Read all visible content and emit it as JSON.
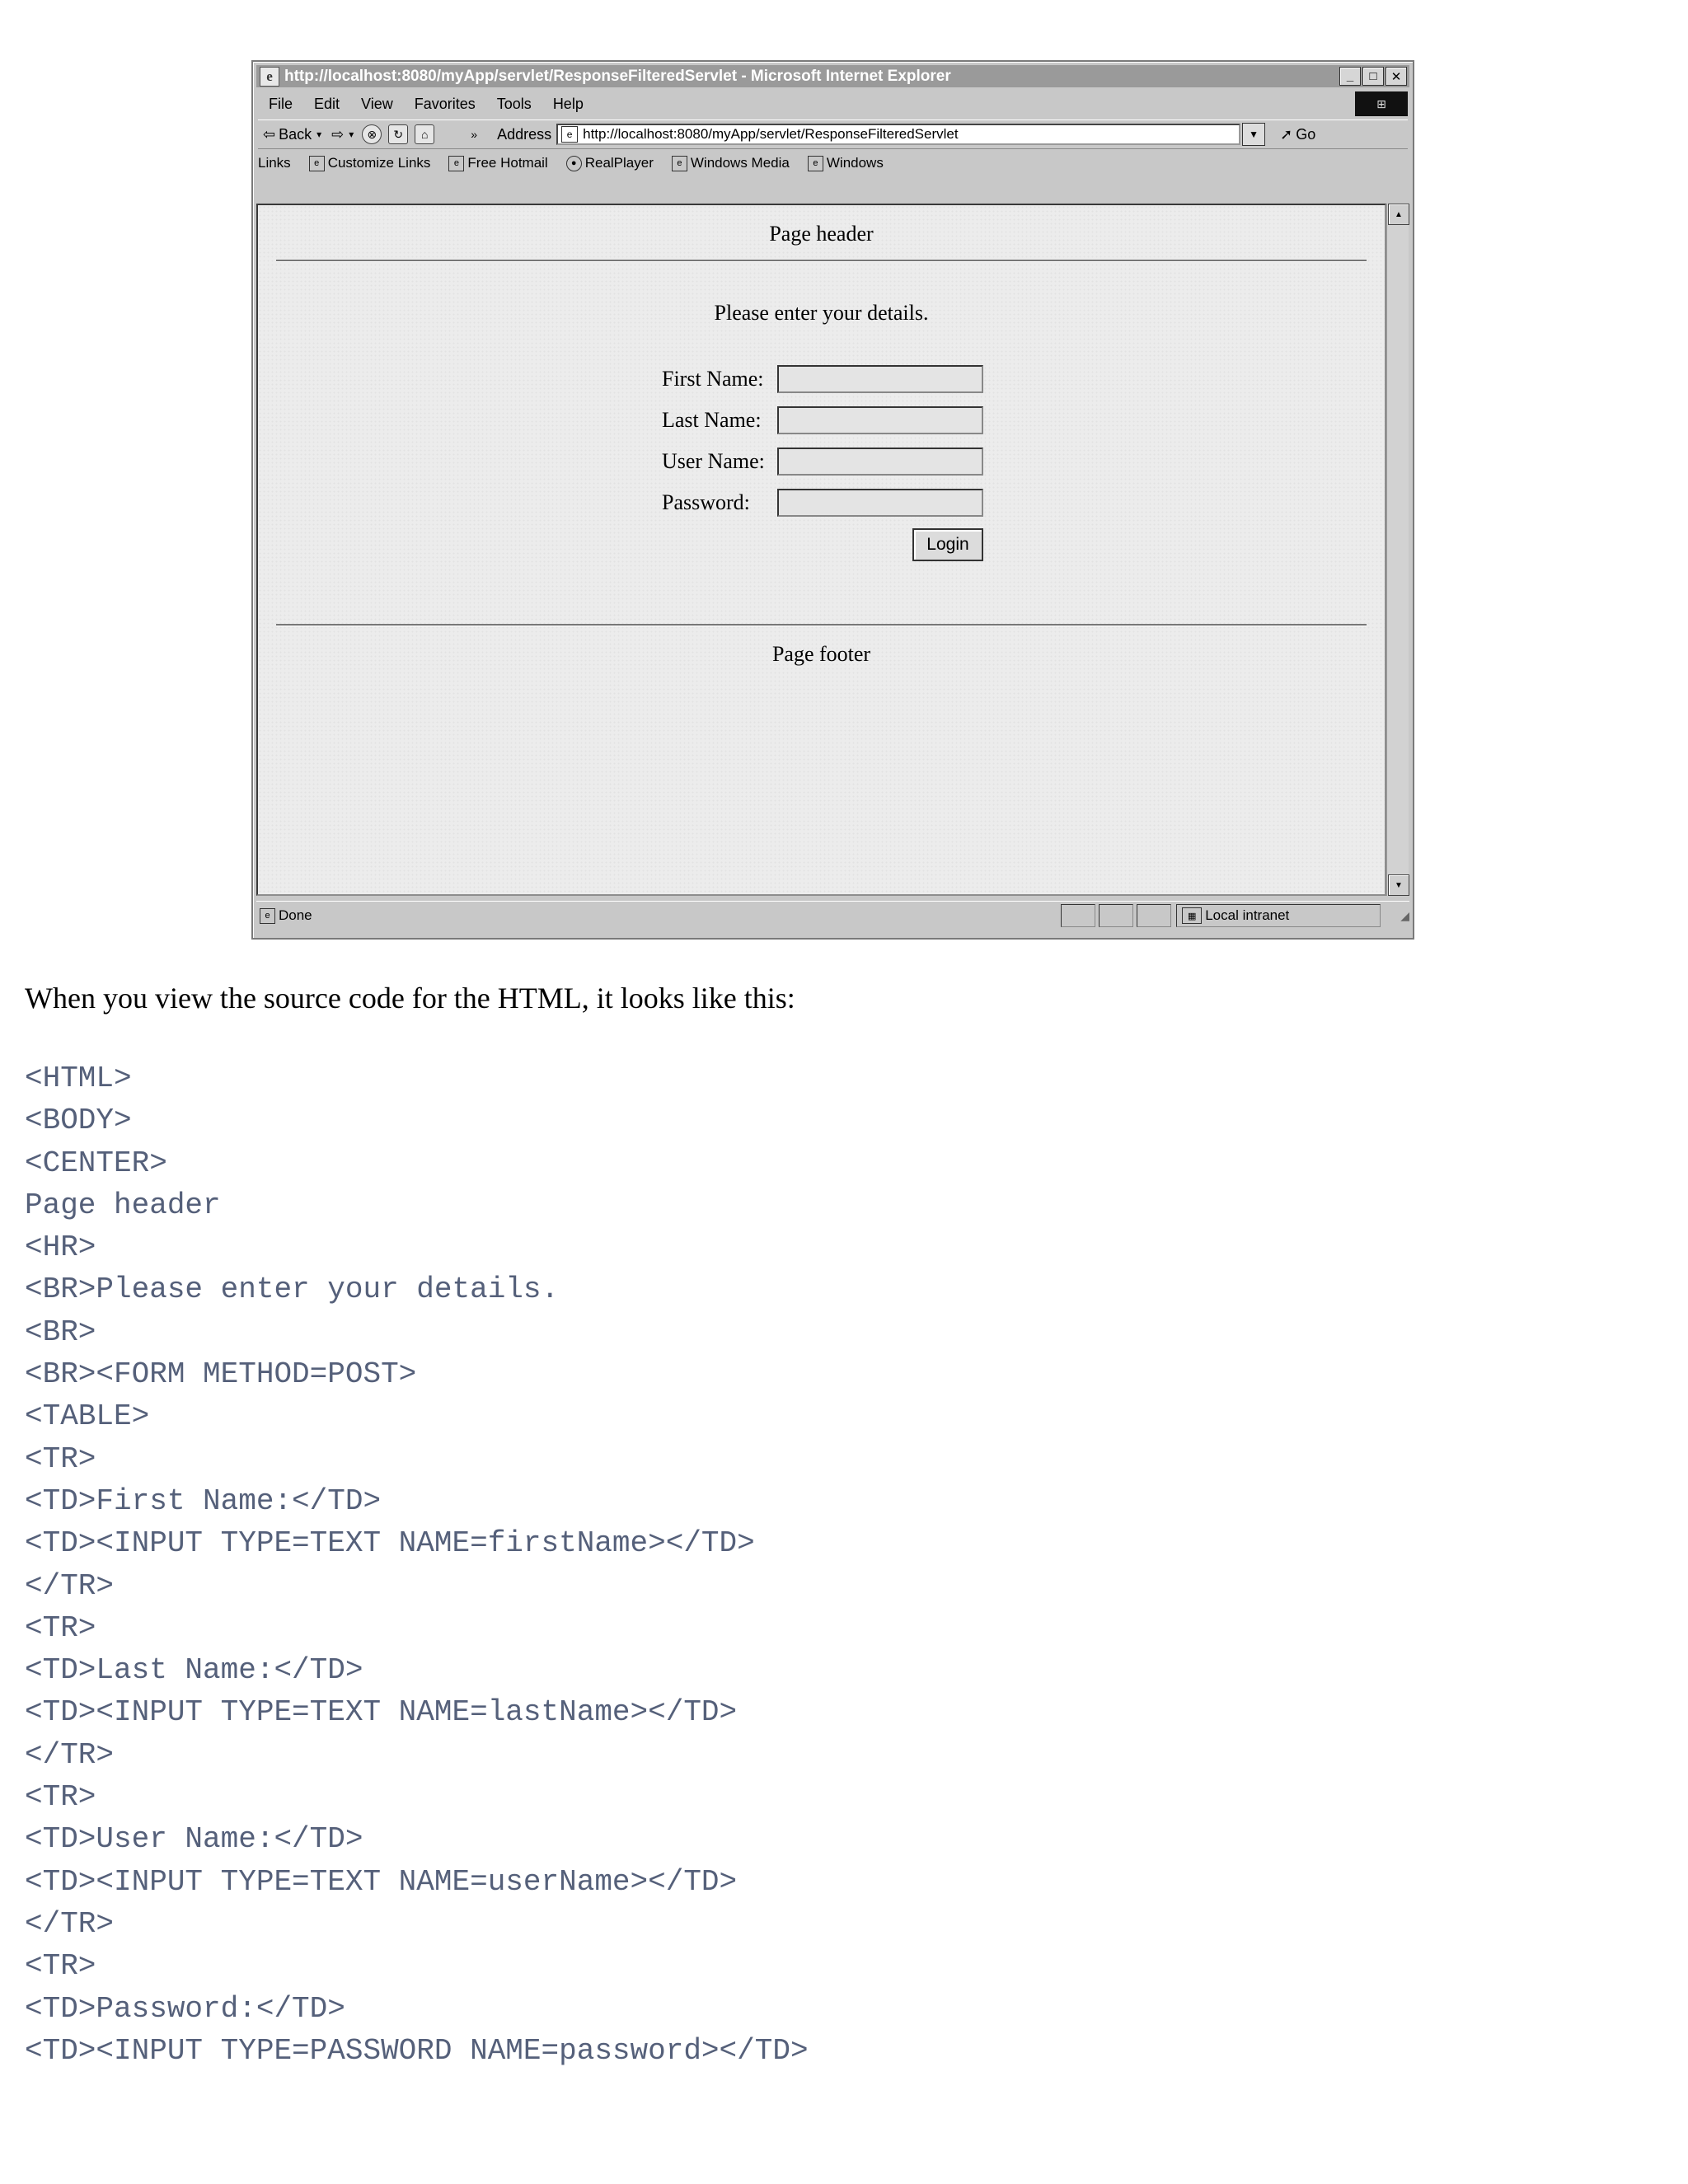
{
  "browser": {
    "title": "http://localhost:8080/myApp/servlet/ResponseFilteredServlet - Microsoft Internet Explorer",
    "menu": [
      "File",
      "Edit",
      "View",
      "Favorites",
      "Tools",
      "Help"
    ],
    "toolbar": {
      "back_label": "Back",
      "address_label": "Address",
      "address_value": "http://localhost:8080/myApp/servlet/ResponseFilteredServlet",
      "go_label": "Go"
    },
    "links_label": "Links",
    "links": [
      "Customize Links",
      "Free Hotmail",
      "RealPlayer",
      "Windows Media",
      "Windows"
    ],
    "page": {
      "header": "Page header",
      "intro": "Please enter your details.",
      "fields": [
        {
          "label": "First Name:"
        },
        {
          "label": "Last Name:"
        },
        {
          "label": "User Name:"
        },
        {
          "label": "Password:"
        }
      ],
      "login_label": "Login",
      "footer": "Page footer"
    },
    "status": {
      "text": "Done",
      "zone": "Local intranet"
    }
  },
  "document": {
    "prose": "When you view the source code for the HTML, it looks like this:",
    "code_lines": [
      "<HTML>",
      "<BODY>",
      "<CENTER>",
      "Page header",
      "<HR>",
      "<BR>Please enter your details.",
      "<BR>",
      "<BR><FORM METHOD=POST>",
      "<TABLE>",
      "<TR>",
      "<TD>First Name:</TD>",
      "<TD><INPUT TYPE=TEXT NAME=firstName></TD>",
      "</TR>",
      "<TR>",
      "<TD>Last Name:</TD>",
      "<TD><INPUT TYPE=TEXT NAME=lastName></TD>",
      "</TR>",
      "<TR>",
      "<TD>User Name:</TD>",
      "<TD><INPUT TYPE=TEXT NAME=userName></TD>",
      "</TR>",
      "<TR>",
      "<TD>Password:</TD>",
      "<TD><INPUT TYPE=PASSWORD NAME=password></TD>"
    ]
  }
}
